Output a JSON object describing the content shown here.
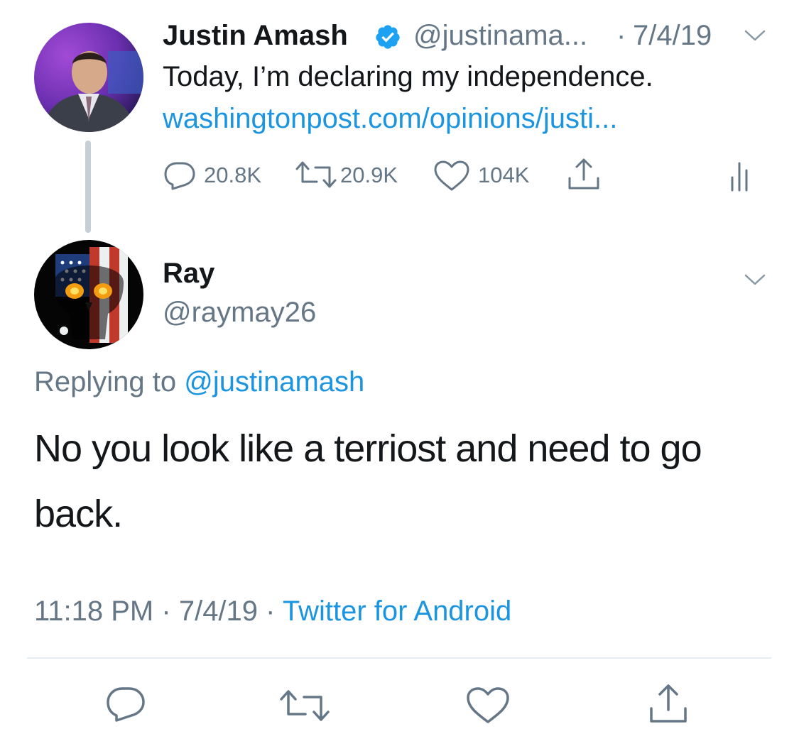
{
  "quoted_tweet": {
    "name": "Justin Amash",
    "handle": "@justinama...",
    "date": "7/4/19",
    "date_sep": "·",
    "text": "Today, I’m declaring my independence.",
    "link": "washingtonpost.com/opinions/justi...",
    "replies": "20.8K",
    "retweets": "20.9K",
    "likes": "104K"
  },
  "reply": {
    "name": "Ray",
    "handle": "@raymay26",
    "replying_prefix": "Replying to",
    "replying_to": "@justinamash",
    "text": "No you look like a terriost and need to go back.",
    "time": "11:18 PM",
    "sep1": "·",
    "date": "7/4/19",
    "sep2": "·",
    "source": "Twitter for Android"
  },
  "colors": {
    "link": "#1b95e0",
    "secondary_text": "#657786",
    "verified": "#1da1f2",
    "icon": "#657786"
  },
  "icons": [
    "verified-badge-icon",
    "chevron-down-icon",
    "reply-icon",
    "retweet-icon",
    "like-icon",
    "share-icon",
    "analytics-icon"
  ]
}
